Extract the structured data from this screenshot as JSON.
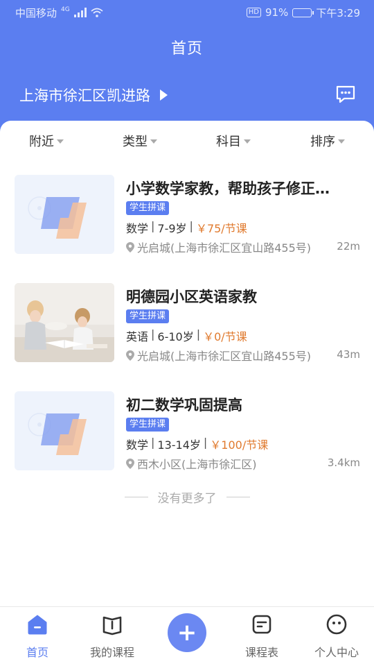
{
  "status_bar": {
    "carrier": "中国移动",
    "network": "4G",
    "hd": "HD",
    "battery": "91%",
    "battery_level": 0.91,
    "time": "下午3:29"
  },
  "header": {
    "title": "首页",
    "location": "上海市徐汇区凯进路",
    "message_icon": "chat-bubble-icon"
  },
  "filters": [
    {
      "label": "附近"
    },
    {
      "label": "类型"
    },
    {
      "label": "科目"
    },
    {
      "label": "排序"
    }
  ],
  "courses": [
    {
      "title": "小学数学家教，帮助孩子修正…",
      "badge": "学生拼课",
      "subject": "数学",
      "age": "7-9岁",
      "price": "￥75/节课",
      "address": "光启城(上海市徐汇区宜山路455号)",
      "distance": "22m",
      "thumb": "placeholder-logo"
    },
    {
      "title": "明德园小区英语家教",
      "badge": "学生拼课",
      "subject": "英语",
      "age": "6-10岁",
      "price": "￥0/节课",
      "address": "光启城(上海市徐汇区宜山路455号)",
      "distance": "43m",
      "thumb": "children-reading-photo"
    },
    {
      "title": "初二数学巩固提高",
      "badge": "学生拼课",
      "subject": "数学",
      "age": "13-14岁",
      "price": "￥100/节课",
      "address": "西木小区(上海市徐汇区)",
      "distance": "3.4km",
      "thumb": "placeholder-logo"
    }
  ],
  "list_footer": "没有更多了",
  "tabbar": {
    "items": [
      {
        "label": "首页",
        "icon": "home-icon",
        "active": true
      },
      {
        "label": "我的课程",
        "icon": "book-icon",
        "active": false
      },
      {
        "label": "",
        "icon": "plus-icon",
        "active": false
      },
      {
        "label": "课程表",
        "icon": "schedule-icon",
        "active": false
      },
      {
        "label": "个人中心",
        "icon": "profile-face-icon",
        "active": false
      }
    ]
  },
  "colors": {
    "primary": "#5b7ef0",
    "price": "#e07a2e",
    "badge": "#5b7ef0"
  }
}
